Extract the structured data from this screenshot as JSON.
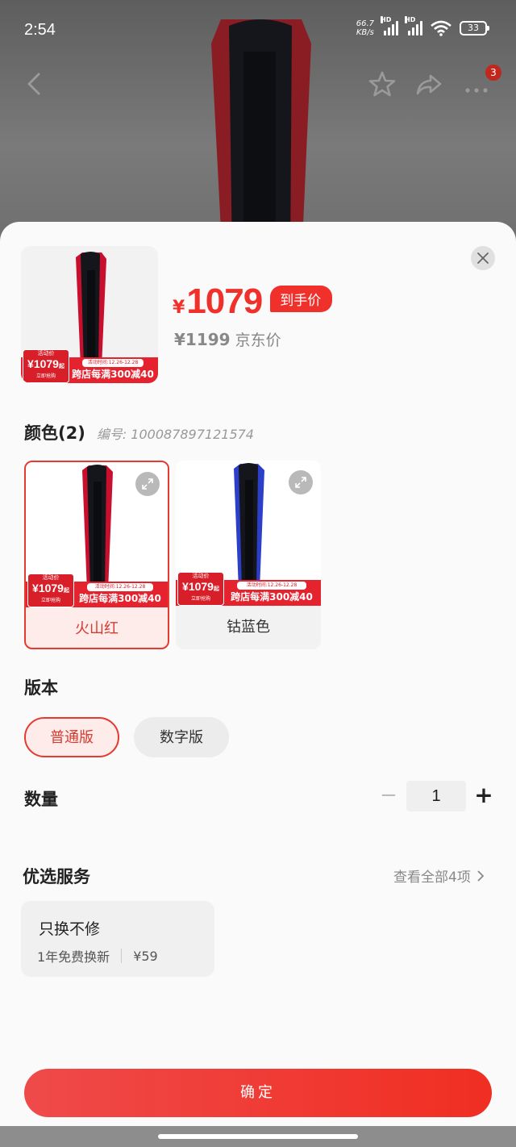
{
  "status_bar": {
    "time": "2:54",
    "net_speed_value": "66.7",
    "net_speed_unit": "KB/s",
    "hd_label": "HD",
    "battery": "33"
  },
  "nav": {
    "cart_badge": "3",
    "icons": [
      "back-icon",
      "star-icon",
      "share-icon",
      "more-icon"
    ]
  },
  "product": {
    "price_symbol": "¥",
    "price": "1079",
    "price_tag": "到手价",
    "jd_price": "¥1199",
    "jd_label": "京东价"
  },
  "promo_banner": {
    "event_label": "活动价",
    "event_price": "¥1079",
    "event_price_suffix": "起",
    "buy_now": "立即抢购",
    "event_time": "活动时间:12.26-12.28",
    "discount": "跨店每满300减40"
  },
  "color_section": {
    "title": "颜色(2)",
    "sku": "编号: 100087897121574",
    "options": [
      {
        "label": "火山红",
        "selected": true,
        "color": "#c8102e"
      },
      {
        "label": "钴蓝色",
        "selected": false,
        "color": "#2b3fc9"
      }
    ]
  },
  "edition_section": {
    "title": "版本",
    "options": [
      {
        "label": "普通版",
        "selected": true
      },
      {
        "label": "数字版",
        "selected": false
      }
    ]
  },
  "quantity": {
    "title": "数量",
    "minus": "−",
    "value": "1",
    "plus": "+"
  },
  "services": {
    "title": "优选服务",
    "view_all": "查看全部4项",
    "items": [
      {
        "name": "只换不修",
        "desc": "1年免费换新",
        "price": "¥59"
      }
    ]
  },
  "confirm_label": "确定",
  "colors": {
    "accent": "#f0302a",
    "selected_border": "#e53a30",
    "selected_bg": "#fdecea"
  }
}
